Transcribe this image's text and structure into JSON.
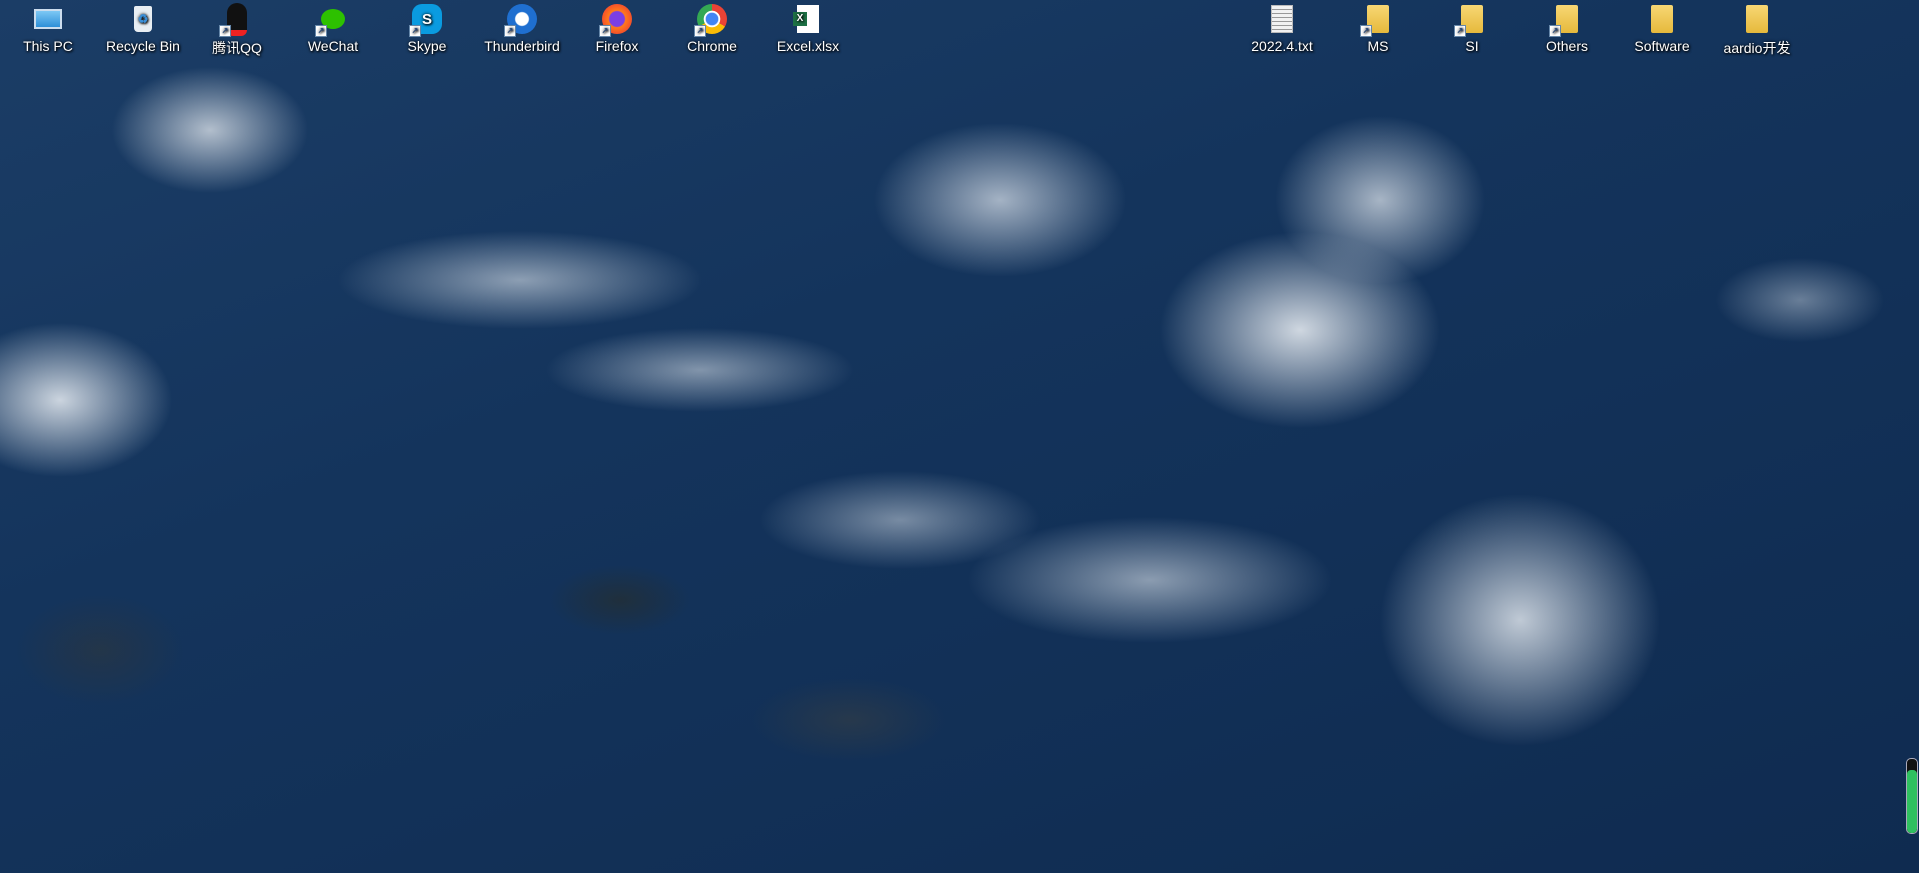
{
  "desktop": {
    "left_icons": [
      {
        "label": "This PC",
        "icon": "computer-icon"
      },
      {
        "label": "Recycle Bin",
        "icon": "recycle-bin-icon"
      },
      {
        "label": "腾讯QQ",
        "icon": "qq-penguin-icon"
      },
      {
        "label": "WeChat",
        "icon": "wechat-icon"
      },
      {
        "label": "Skype",
        "icon": "skype-icon"
      },
      {
        "label": "Thunderbird",
        "icon": "thunderbird-icon"
      },
      {
        "label": "Firefox",
        "icon": "firefox-icon"
      },
      {
        "label": "Chrome",
        "icon": "chrome-icon"
      },
      {
        "label": "Excel.xlsx",
        "icon": "excel-file-icon"
      }
    ],
    "right_icons": [
      {
        "label": "2022.4.txt",
        "icon": "text-file-icon"
      },
      {
        "label": "MS",
        "icon": "folder-icon"
      },
      {
        "label": "SI",
        "icon": "folder-icon"
      },
      {
        "label": "Others",
        "icon": "folder-icon"
      },
      {
        "label": "Software",
        "icon": "folder-icon"
      },
      {
        "label": "aardio开发",
        "icon": "folder-icon"
      }
    ]
  },
  "level_gauge": {
    "fill_percent": 85,
    "color": "#2fc060"
  }
}
